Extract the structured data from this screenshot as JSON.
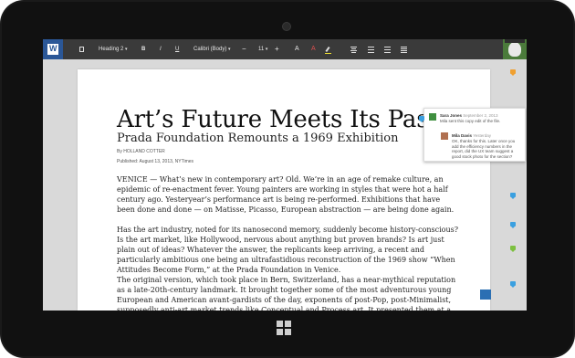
{
  "toolbar": {
    "app_icon": "word-icon",
    "style_dropdown": "Heading 2",
    "font_dropdown": "Calibri (Body)",
    "font_size": "11",
    "bold": "B",
    "italic": "I",
    "underline": "U",
    "font_color_letter": "A",
    "text_color_letter": "A",
    "decrease": "−",
    "increase": "+"
  },
  "article": {
    "headline": "Art’s Future Meets Its Past",
    "subhead": "Prada Foundation Remounts a 1969 Exhibition",
    "byline": "By HOLLAND COTTER",
    "published": "Published: August 13, 2013, NYTimes",
    "paragraphs": [
      "VENICE — What’s new in contemporary art? Old. We’re in an age of remake culture, an epidemic of re-enactment fever. Young painters are working in styles that were hot a half century ago. Yesteryear’s performance art is being re-performed. Exhibitions that have been done and done — on Matisse, Picasso, European abstraction — are being done again.",
      "Has the art industry, noted for its nanosecond memory, suddenly become history-conscious? Is the art market, like Hollywood, nervous about anything but proven brands? Is art just plain out of ideas? Whatever the answer, the replicants keep arriving, a recent and particularly ambitious one being an ultrafastidious reconstruction of the 1969 show “When Attitudes Become Form,” at the Prada Foundation in Venice.",
      "The original version, which took place in Bern, Switzerland, has a near-mythical reputation as a late-20th-century landmark. It brought together some of the most adventurous young European and American avant-gardists of the day, exponents of post-Pop, post-Minimalist, supposedly anti-art market trends like Conceptual and Process art. It presented them at a high moment of political and cultural turmoil internationally, and in what has been perceived as a radically loosened-up exhibition format, with art created communally, spontaneously, on the spot."
    ]
  },
  "comments": {
    "first": {
      "author": "Sara Jones",
      "date": "September 2, 2013",
      "text": "Mila sent this copy edit of the file."
    },
    "reply": {
      "author": "Mila Davis",
      "date": "Yesterday",
      "text": "OK, thanks for this. Later once you add the efficiency numbers in the report, did the UX team suggest a good stock photo for the section?"
    }
  },
  "colors": {
    "toolbar": "#3a3a3a",
    "brand": "#2b5797",
    "comment_blue": "#3ba0e0",
    "comment_orange": "#f0a030",
    "comment_green": "#7dc040"
  }
}
